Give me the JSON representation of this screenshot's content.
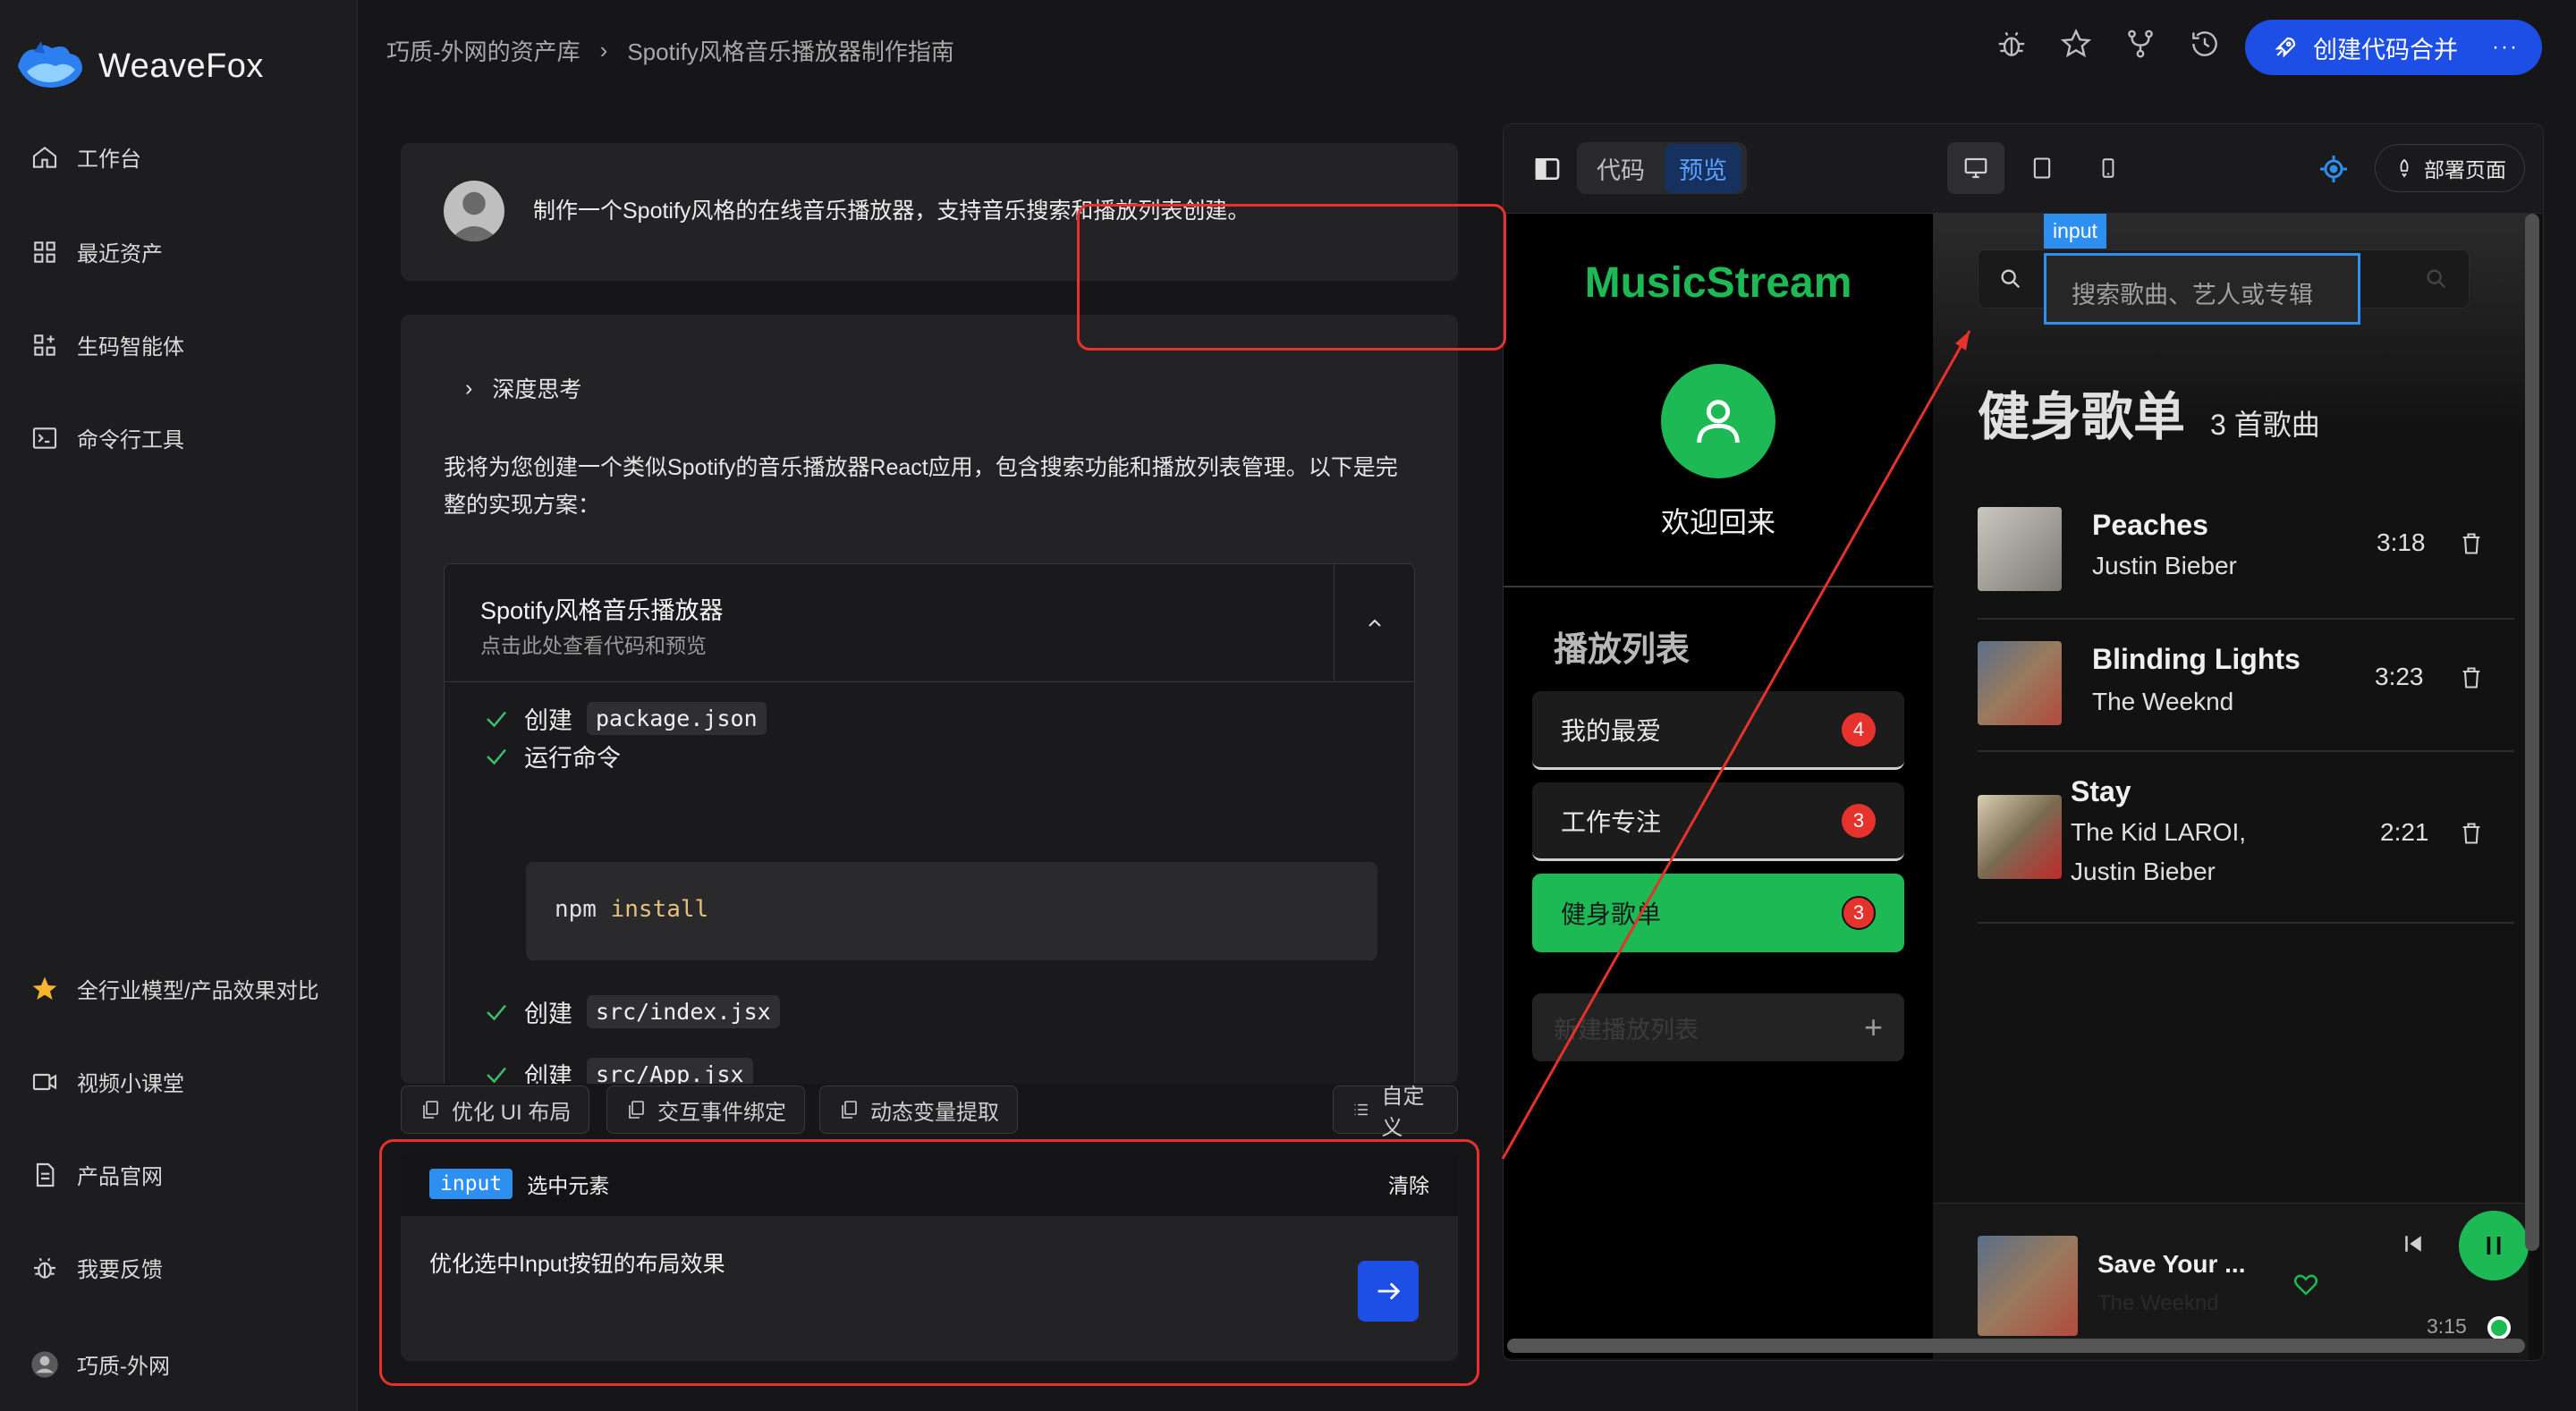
{
  "app": {
    "logo_text": "WeaveFox",
    "user_name": "巧质-外网"
  },
  "sidebar": {
    "items": [
      {
        "label": "工作台",
        "icon": "home-icon"
      },
      {
        "label": "最近资产",
        "icon": "grid-icon"
      },
      {
        "label": "生码智能体",
        "icon": "apps-icon"
      },
      {
        "label": "命令行工具",
        "icon": "terminal-icon"
      }
    ],
    "bottom_items": [
      {
        "label": "全行业模型/产品效果对比",
        "icon": "star-icon"
      },
      {
        "label": "视频小课堂",
        "icon": "video-icon"
      },
      {
        "label": "产品官网",
        "icon": "document-icon"
      },
      {
        "label": "我要反馈",
        "icon": "bug-icon"
      }
    ]
  },
  "header": {
    "breadcrumb": [
      "巧质-外网的资产库",
      "Spotify风格音乐播放器制作指南"
    ],
    "merge_button": "创建代码合并",
    "more": "···",
    "icons": [
      "bug-icon",
      "star-icon",
      "branch-icon",
      "history-icon"
    ]
  },
  "chat": {
    "user_message": "制作一个Spotify风格的在线音乐播放器，支持音乐搜索和播放列表创建。",
    "think_label": "深度思考",
    "response_text": "我将为您创建一个类似Spotify的音乐播放器React应用，包含搜索功能和播放列表管理。以下是完整的实现方案：",
    "code_card": {
      "title": "Spotify风格音乐播放器",
      "subtitle": "点击此处查看代码和预览",
      "steps": [
        {
          "label": "创建",
          "file": "package.json"
        },
        {
          "label": "运行命令",
          "file": ""
        },
        {
          "label": "创建",
          "file": "src/index.jsx"
        },
        {
          "label": "创建",
          "file": "src/App.jsx"
        }
      ],
      "command": {
        "prefix": "npm",
        "rest": "install"
      }
    },
    "quick_actions": [
      "优化 UI 布局",
      "交互事件绑定",
      "动态变量提取",
      "自定义"
    ],
    "input": {
      "tag": "input",
      "selected_label": "选中元素",
      "clear": "清除",
      "text": "优化选中Input按钮的布局效果"
    }
  },
  "preview": {
    "tabs": [
      "代码",
      "预览"
    ],
    "active_tab": "预览",
    "deploy": "部署页面",
    "music_app": {
      "logo": "MusicStream",
      "welcome": "欢迎回来",
      "playlists_title": "播放列表",
      "playlists": [
        {
          "name": "我的最爱",
          "count": "4"
        },
        {
          "name": "工作专注",
          "count": "3"
        },
        {
          "name": "健身歌单",
          "count": "3"
        }
      ],
      "new_playlist": "新建播放列表",
      "search_placeholder": "搜索歌曲、艺人或专辑",
      "input_tag": "input",
      "current_playlist": "健身歌单",
      "song_count": "3 首歌曲",
      "songs": [
        {
          "title": "Peaches",
          "artist": "Justin Bieber",
          "duration": "3:18"
        },
        {
          "title": "Blinding Lights",
          "artist": "The Weeknd",
          "duration": "3:23"
        },
        {
          "title": "Stay",
          "artist": "The Kid LAROI, Justin Bieber",
          "artist_line1": "The Kid LAROI,",
          "artist_line2": "Justin Bieber",
          "duration": "2:21"
        }
      ],
      "now_playing": {
        "title": "Save Your ...",
        "artist": "The Weeknd",
        "time": "3:15"
      }
    }
  },
  "colors": {
    "accent": "#1d4fe6",
    "spotify_green": "#1db954",
    "highlight_red": "#e5322d",
    "select_blue": "#2d8ff0"
  }
}
